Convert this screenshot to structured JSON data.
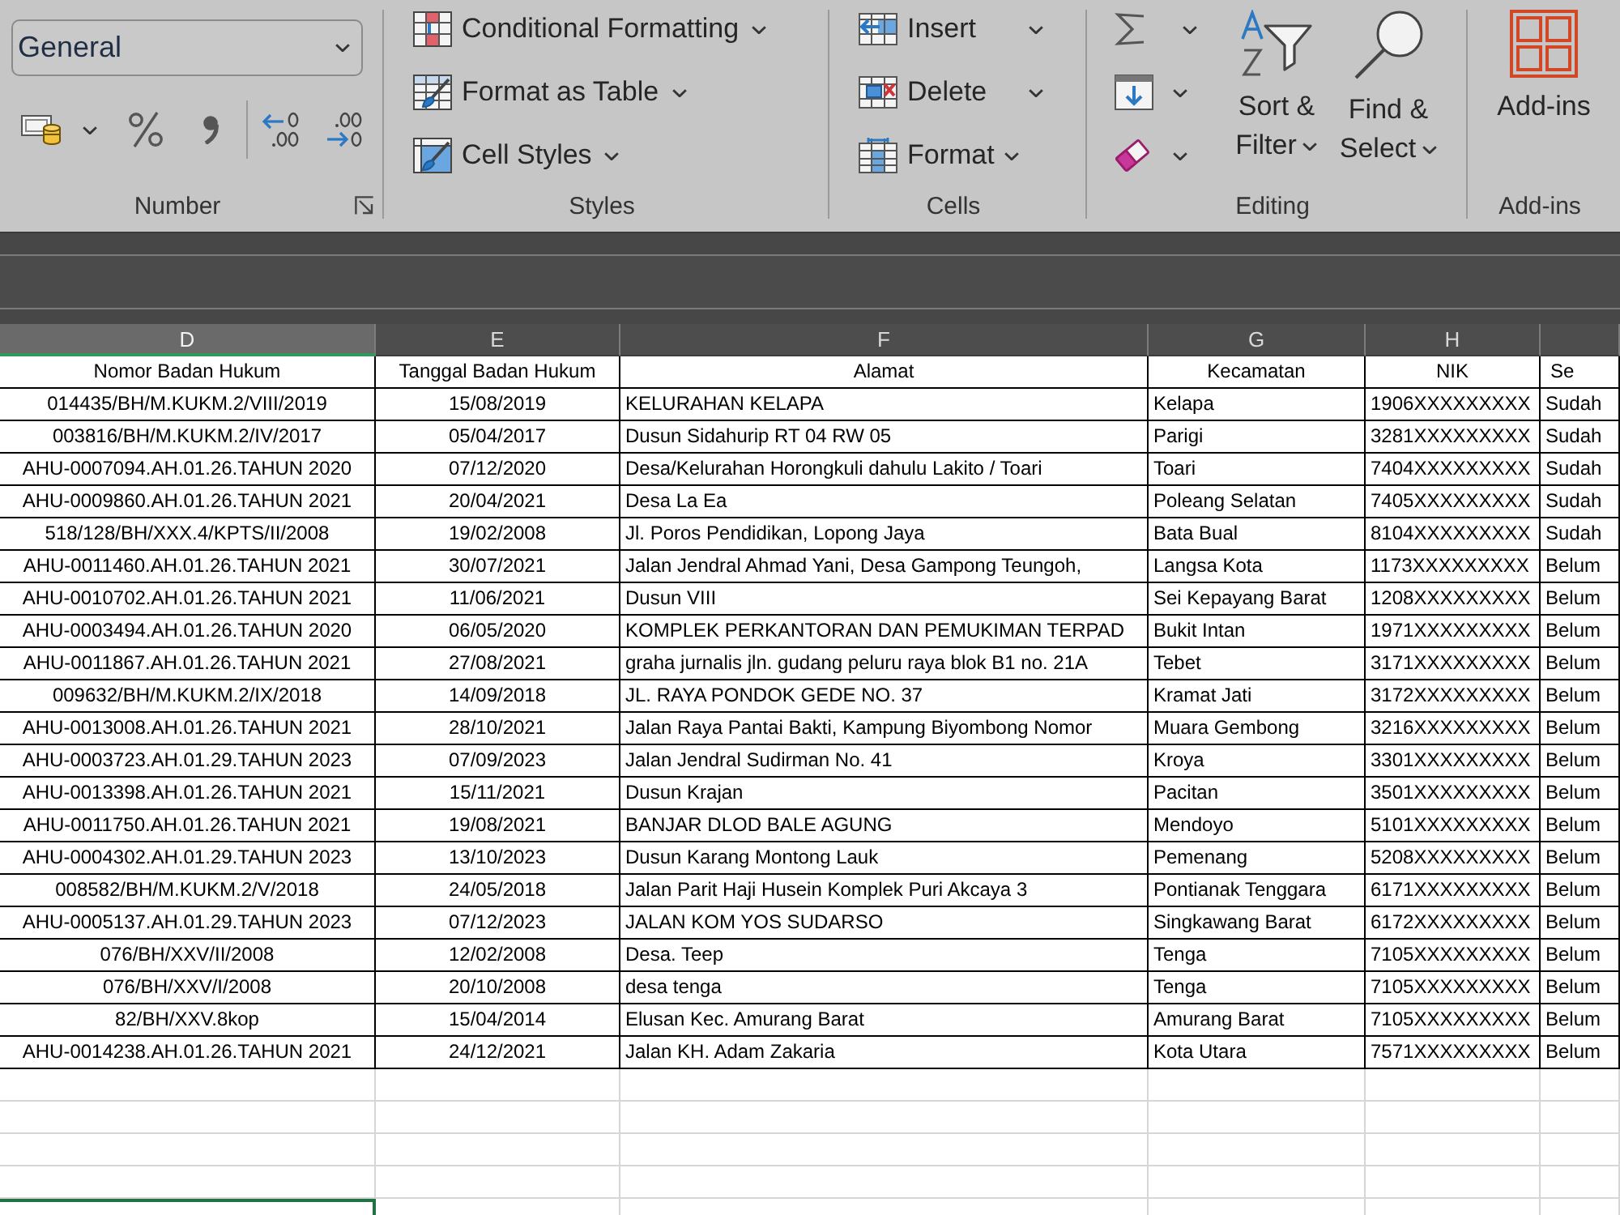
{
  "ribbon": {
    "number_group": {
      "format_dropdown": {
        "value": "General"
      },
      "label": "Number"
    },
    "styles_group": {
      "buttons": [
        {
          "label": "Conditional Formatting"
        },
        {
          "label": "Format as Table"
        },
        {
          "label": "Cell Styles"
        }
      ],
      "label": "Styles"
    },
    "cells_group": {
      "buttons": [
        {
          "label": "Insert",
          "kind": "split"
        },
        {
          "label": "Delete",
          "kind": "split"
        },
        {
          "label": "Format",
          "kind": "menu"
        }
      ],
      "label": "Cells"
    },
    "editing_group": {
      "large_buttons": [
        {
          "label": "Sort & Filter"
        },
        {
          "label": "Find & Select"
        }
      ],
      "label": "Editing"
    },
    "addins_group": {
      "button": {
        "label": "Add-ins"
      },
      "label": "Add-ins"
    }
  },
  "sheet": {
    "columns": [
      {
        "letter": "D",
        "heading": "Nomor Badan Hukum",
        "selected": true
      },
      {
        "letter": "E",
        "heading": "Tanggal Badan Hukum",
        "selected": false
      },
      {
        "letter": "F",
        "heading": "Alamat",
        "selected": false
      },
      {
        "letter": "G",
        "heading": "Kecamatan",
        "selected": false
      },
      {
        "letter": "H",
        "heading": "NIK",
        "selected": false
      },
      {
        "heading": "Se",
        "selected": false
      }
    ],
    "rows": [
      [
        "014435/BH/M.KUKM.2/VIII/2019",
        "15/08/2019",
        "KELURAHAN KELAPA",
        "Kelapa",
        "1906XXXXXXXXX",
        "Sudah"
      ],
      [
        "003816/BH/M.KUKM.2/IV/2017",
        "05/04/2017",
        "Dusun Sidahurip RT 04 RW 05",
        "Parigi",
        "3281XXXXXXXXX",
        "Sudah"
      ],
      [
        "AHU-0007094.AH.01.26.TAHUN 2020",
        "07/12/2020",
        "Desa/Kelurahan Horongkuli dahulu Lakito / Toari",
        "Toari",
        "7404XXXXXXXXX",
        "Sudah"
      ],
      [
        "AHU-0009860.AH.01.26.TAHUN 2021",
        "20/04/2021",
        "Desa La Ea",
        "Poleang Selatan",
        "7405XXXXXXXXX",
        "Sudah"
      ],
      [
        "518/128/BH/XXX.4/KPTS/II/2008",
        "19/02/2008",
        "Jl. Poros Pendidikan, Lopong Jaya",
        "Bata Bual",
        "8104XXXXXXXXX",
        "Sudah"
      ],
      [
        "AHU-0011460.AH.01.26.TAHUN 2021",
        "30/07/2021",
        "Jalan Jendral Ahmad Yani, Desa Gampong Teungoh,",
        "Langsa Kota",
        "1173XXXXXXXXX",
        "Belum"
      ],
      [
        "AHU-0010702.AH.01.26.TAHUN 2021",
        "11/06/2021",
        "Dusun VIII",
        "Sei Kepayang Barat",
        "1208XXXXXXXXX",
        "Belum"
      ],
      [
        "AHU-0003494.AH.01.26.TAHUN 2020",
        "06/05/2020",
        "KOMPLEK PERKANTORAN DAN PEMUKIMAN TERPAD",
        "Bukit Intan",
        "1971XXXXXXXXX",
        "Belum"
      ],
      [
        "AHU-0011867.AH.01.26.TAHUN 2021",
        "27/08/2021",
        "graha jurnalis jln. gudang peluru raya blok B1 no. 21A",
        "Tebet",
        "3171XXXXXXXXX",
        "Belum"
      ],
      [
        "009632/BH/M.KUKM.2/IX/2018",
        "14/09/2018",
        "JL. RAYA PONDOK GEDE NO. 37",
        "Kramat Jati",
        "3172XXXXXXXXX",
        "Belum"
      ],
      [
        "AHU-0013008.AH.01.26.TAHUN 2021",
        "28/10/2021",
        "Jalan Raya Pantai Bakti, Kampung Biyombong Nomor",
        "Muara Gembong",
        "3216XXXXXXXXX",
        "Belum"
      ],
      [
        "AHU-0003723.AH.01.29.TAHUN 2023",
        "07/09/2023",
        "Jalan Jendral Sudirman No. 41",
        "Kroya",
        "3301XXXXXXXXX",
        "Belum"
      ],
      [
        "AHU-0013398.AH.01.26.TAHUN 2021",
        "15/11/2021",
        "Dusun Krajan",
        "Pacitan",
        "3501XXXXXXXXX",
        "Belum"
      ],
      [
        "AHU-0011750.AH.01.26.TAHUN 2021",
        "19/08/2021",
        "BANJAR DLOD BALE AGUNG",
        "Mendoyo",
        "5101XXXXXXXXX",
        "Belum"
      ],
      [
        "AHU-0004302.AH.01.29.TAHUN 2023",
        "13/10/2023",
        "Dusun Karang Montong Lauk",
        "Pemenang",
        "5208XXXXXXXXX",
        "Belum"
      ],
      [
        "008582/BH/M.KUKM.2/V/2018",
        "24/05/2018",
        "Jalan Parit Haji Husein Komplek Puri Akcaya 3",
        "Pontianak Tenggara",
        "6171XXXXXXXXX",
        "Belum"
      ],
      [
        "AHU-0005137.AH.01.29.TAHUN 2023",
        "07/12/2023",
        "JALAN KOM YOS SUDARSO",
        "Singkawang Barat",
        "6172XXXXXXXXX",
        "Belum"
      ],
      [
        "076/BH/XXV/II/2008",
        "12/02/2008",
        "Desa. Teep",
        "Tenga",
        "7105XXXXXXXXX",
        "Belum"
      ],
      [
        "076/BH/XXV/I/2008",
        "20/10/2008",
        "desa tenga",
        "Tenga",
        "7105XXXXXXXXX",
        "Belum"
      ],
      [
        "82/BH/XXV.8kop",
        "15/04/2014",
        "Elusan Kec. Amurang Barat",
        "Amurang Barat",
        "7105XXXXXXXXX",
        "Belum"
      ],
      [
        "AHU-0014238.AH.01.26.TAHUN 2021",
        "24/12/2021",
        "Jalan KH. Adam Zakaria",
        "Kota Utara",
        "7571XXXXXXXXX",
        "Belum"
      ]
    ]
  }
}
